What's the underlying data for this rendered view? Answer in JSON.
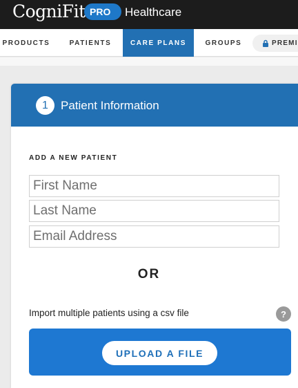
{
  "brand": {
    "logo_text": "CogniFit",
    "badge": "PRO",
    "subtitle": "Healthcare"
  },
  "nav": {
    "items": [
      {
        "label": "PRODUCTS",
        "active": false
      },
      {
        "label": "PATIENTS",
        "active": false
      },
      {
        "label": "CARE PLANS",
        "active": true
      },
      {
        "label": "GROUPS",
        "active": false
      }
    ],
    "premium_label": "PREMIU",
    "premium_icon": "lock-icon"
  },
  "card": {
    "step_number": "1",
    "title": "Patient Information",
    "section_label": "ADD A NEW PATIENT",
    "fields": {
      "first_name_placeholder": "First Name",
      "last_name_placeholder": "Last Name",
      "email_placeholder": "Email Address"
    },
    "or_label": "OR",
    "import_text": "Import multiple patients using a csv file",
    "help_icon": "?",
    "upload_label": "UPLOAD A FILE"
  },
  "colors": {
    "primary": "#2270b3",
    "upload_panel": "#1e78d2",
    "brand_bar": "#1c1c1c"
  }
}
